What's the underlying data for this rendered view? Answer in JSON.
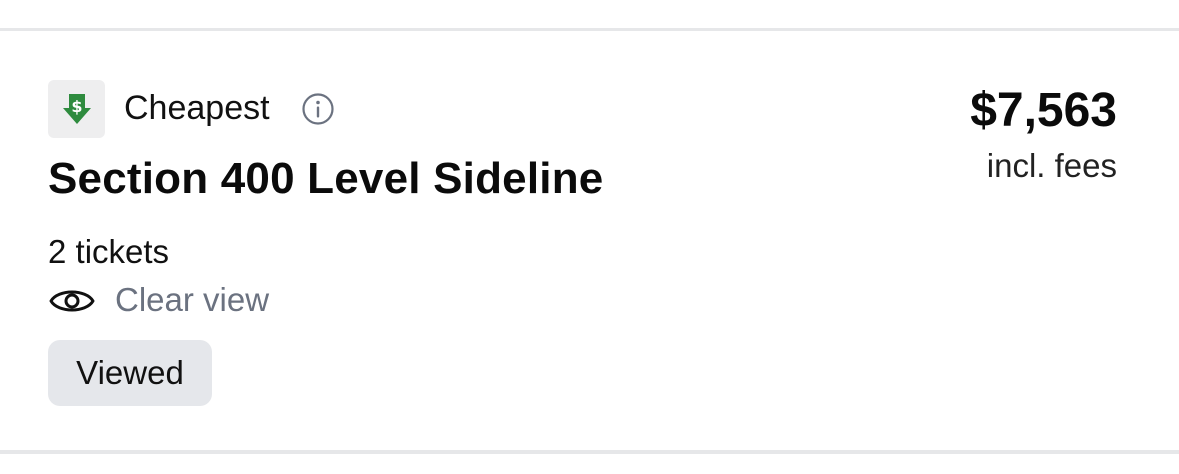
{
  "listing": {
    "badge_label": "Cheapest",
    "badge_icon": "dollar-down-arrow-icon",
    "badge_icon_color": "#2e8b3e",
    "section_name": "Section 400 Level Sideline",
    "ticket_count": "2 tickets",
    "view_quality": "Clear view",
    "view_icon": "eye-icon",
    "viewed_badge": "Viewed",
    "price": "$7,563",
    "price_note": "incl. fees"
  }
}
